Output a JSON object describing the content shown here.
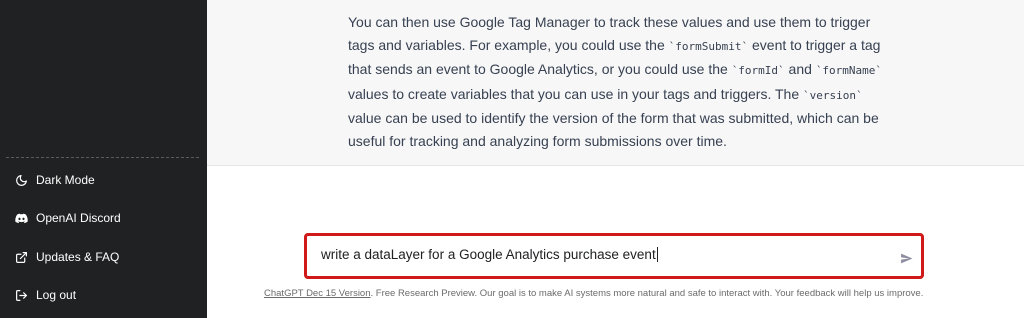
{
  "sidebar": {
    "items": [
      {
        "icon": "moon-icon",
        "label": "Dark Mode"
      },
      {
        "icon": "discord-icon",
        "label": "OpenAI Discord"
      },
      {
        "icon": "external-link-icon",
        "label": "Updates & FAQ"
      },
      {
        "icon": "logout-icon",
        "label": "Log out"
      }
    ]
  },
  "answer": {
    "p1": "You can then use Google Tag Manager to track these values and use them to trigger tags and variables. For example, you could use the ",
    "code1": "`formSubmit`",
    "p2": " event to trigger a tag that sends an event to Google Analytics, or you could use the ",
    "code2": "`formId`",
    "p3": " and ",
    "code3": "`formName`",
    "p4": " values to create variables that you can use in your tags and triggers. The ",
    "code4": "`version`",
    "p5": " value can be used to identify the version of the form that was submitted, which can be useful for tracking and analyzing form submissions over time."
  },
  "composer": {
    "value": "write a dataLayer for a Google Analytics purchase event",
    "send_icon": "send-icon",
    "highlight_color": "#d11919"
  },
  "footer": {
    "link": "ChatGPT Dec 15 Version",
    "text": ". Free Research Preview. Our goal is to make AI systems more natural and safe to interact with. Your feedback will help us improve."
  }
}
